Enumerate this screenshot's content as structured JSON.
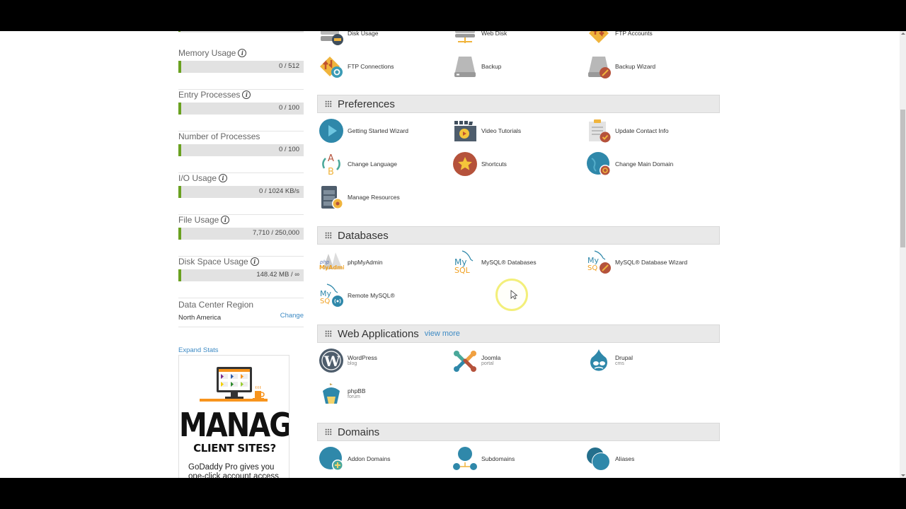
{
  "sidebar": {
    "stats": [
      {
        "label": "Memory Usage",
        "value": "0 / 512",
        "info": true,
        "usage_fraction": 0
      },
      {
        "label": "Entry Processes",
        "value": "0 / 100",
        "info": true,
        "usage_fraction": 0
      },
      {
        "label": "Number of Processes",
        "value": "0 / 100",
        "info": false,
        "usage_fraction": 0
      },
      {
        "label": "I/O Usage",
        "value": "0 / 1024 KB/s",
        "info": true,
        "usage_fraction": 0
      },
      {
        "label": "File Usage",
        "value": "7,710 / 250,000",
        "info": true,
        "usage_fraction": 0.03
      },
      {
        "label": "Disk Space Usage",
        "value": "148.42 MB / ∞",
        "info": true,
        "usage_fraction": 0
      }
    ],
    "data_center": {
      "label": "Data Center Region",
      "value": "North America",
      "change_label": "Change"
    },
    "expand_stats_label": "Expand Stats",
    "ad": {
      "headline": "MANAGE",
      "subheadline": "CLIENT SITES?",
      "body": "GoDaddy Pro gives you one-click account access"
    }
  },
  "colors": {
    "usage_bar_accent": "#6aa120",
    "link": "#3d8ac4",
    "group_header_bg": "#e9e9e9"
  },
  "groups": {
    "files_partial": {
      "items": [
        {
          "label": "Disk Usage",
          "icon": "disk-usage-icon"
        },
        {
          "label": "Web Disk",
          "icon": "web-disk-icon"
        },
        {
          "label": "FTP Accounts",
          "icon": "ftp-accounts-icon"
        },
        {
          "label": "FTP Connections",
          "icon": "ftp-connections-icon"
        },
        {
          "label": "Backup",
          "icon": "backup-icon"
        },
        {
          "label": "Backup Wizard",
          "icon": "backup-wizard-icon"
        }
      ]
    },
    "preferences": {
      "title": "Preferences",
      "items": [
        {
          "label": "Getting Started Wizard",
          "icon": "play-icon"
        },
        {
          "label": "Video Tutorials",
          "icon": "clapperboard-icon"
        },
        {
          "label": "Update Contact Info",
          "icon": "contact-info-icon"
        },
        {
          "label": "Change Language",
          "icon": "language-icon"
        },
        {
          "label": "Shortcuts",
          "icon": "star-icon"
        },
        {
          "label": "Change Main Domain",
          "icon": "globe-refresh-icon"
        },
        {
          "label": "Manage Resources",
          "icon": "server-gear-icon"
        }
      ]
    },
    "databases": {
      "title": "Databases",
      "items": [
        {
          "label": "phpMyAdmin",
          "icon": "phpmyadmin-icon"
        },
        {
          "label": "MySQL® Databases",
          "icon": "mysql-icon"
        },
        {
          "label": "MySQL® Database Wizard",
          "icon": "mysql-wizard-icon"
        },
        {
          "label": "Remote MySQL®",
          "icon": "remote-mysql-icon"
        }
      ]
    },
    "web_applications": {
      "title": "Web Applications",
      "view_more_label": "view more",
      "items": [
        {
          "label": "WordPress",
          "sub": "blog",
          "icon": "wordpress-icon"
        },
        {
          "label": "Joomla",
          "sub": "portal",
          "icon": "joomla-icon"
        },
        {
          "label": "Drupal",
          "sub": "cms",
          "icon": "drupal-icon"
        },
        {
          "label": "phpBB",
          "sub": "forum",
          "icon": "phpbb-icon"
        }
      ]
    },
    "domains": {
      "title": "Domains",
      "items": [
        {
          "label": "Addon Domains",
          "icon": "globe-plus-icon"
        },
        {
          "label": "Subdomains",
          "icon": "subdomains-icon"
        },
        {
          "label": "Aliases",
          "icon": "aliases-icon"
        }
      ]
    }
  }
}
